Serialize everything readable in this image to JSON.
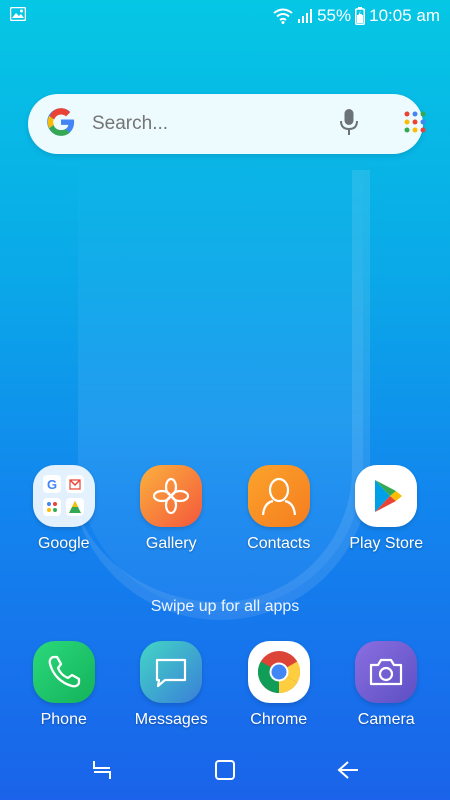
{
  "status_bar": {
    "battery": "55%",
    "time": "10:05 am",
    "icons": [
      "image-icon",
      "wifi-icon",
      "signal-icon",
      "battery-icon"
    ]
  },
  "search": {
    "placeholder": "Search...",
    "icons": [
      "google-logo-icon",
      "mic-icon",
      "app-grid-icon"
    ]
  },
  "apps_row": [
    {
      "label": "Google",
      "icon": "google-folder-icon"
    },
    {
      "label": "Gallery",
      "icon": "gallery-icon"
    },
    {
      "label": "Contacts",
      "icon": "contacts-icon"
    },
    {
      "label": "Play Store",
      "icon": "play-store-icon"
    }
  ],
  "swipe_hint": "Swipe up for all apps",
  "dock": [
    {
      "label": "Phone",
      "icon": "phone-icon"
    },
    {
      "label": "Messages",
      "icon": "messages-icon"
    },
    {
      "label": "Chrome",
      "icon": "chrome-icon"
    },
    {
      "label": "Camera",
      "icon": "camera-icon"
    }
  ],
  "nav": [
    "recents-icon",
    "home-icon",
    "back-icon"
  ],
  "colors": {
    "gallery": "#f57f3c",
    "contacts": "#f7941d",
    "phone": "#1fc567",
    "messages": "#3a8fd8",
    "camera": "#6e5fc9"
  }
}
